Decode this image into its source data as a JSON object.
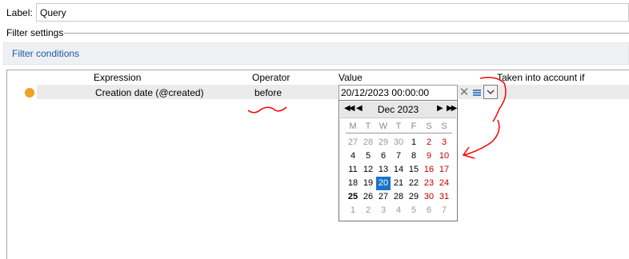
{
  "label": {
    "caption": "Label:",
    "value": "Query"
  },
  "filter_settings": {
    "title": "Filter settings",
    "conditions_label": "Filter conditions"
  },
  "grid": {
    "headers": {
      "expression": "Expression",
      "operator": "Operator",
      "value": "Value",
      "taken_into_account": "Taken into account if"
    },
    "row": {
      "expression": "Creation date (@created)",
      "operator": "before",
      "value": "20/12/2023 00:00:00"
    }
  },
  "colors": {
    "status_dot": "#f0a227",
    "link": "#1b5aa6",
    "selected_day": "#1a73c7",
    "weekend": "#c00000",
    "annotation": "#ff0000"
  },
  "icons": {
    "clear": "clear-icon",
    "list": "list-icon",
    "dropdown": "chevron-down-icon"
  },
  "calendar": {
    "month_label": "Dec 2023",
    "nav": {
      "prev_year": "◀◀",
      "prev_month": "◀",
      "next_month": "▶",
      "next_year": "▶▶"
    },
    "weekdays": [
      "M",
      "T",
      "W",
      "T",
      "F",
      "S",
      "S"
    ],
    "weeks": [
      [
        "27",
        "28",
        "29",
        "30",
        "1",
        "2",
        "3"
      ],
      [
        "4",
        "5",
        "6",
        "7",
        "8",
        "9",
        "10"
      ],
      [
        "11",
        "12",
        "13",
        "14",
        "15",
        "16",
        "17"
      ],
      [
        "18",
        "19",
        "20",
        "21",
        "22",
        "23",
        "24"
      ],
      [
        "25",
        "26",
        "27",
        "28",
        "29",
        "30",
        "31"
      ],
      [
        "1",
        "2",
        "3",
        "4",
        "5",
        "6",
        "7"
      ]
    ],
    "selected_day": "20",
    "today_day": "25"
  }
}
